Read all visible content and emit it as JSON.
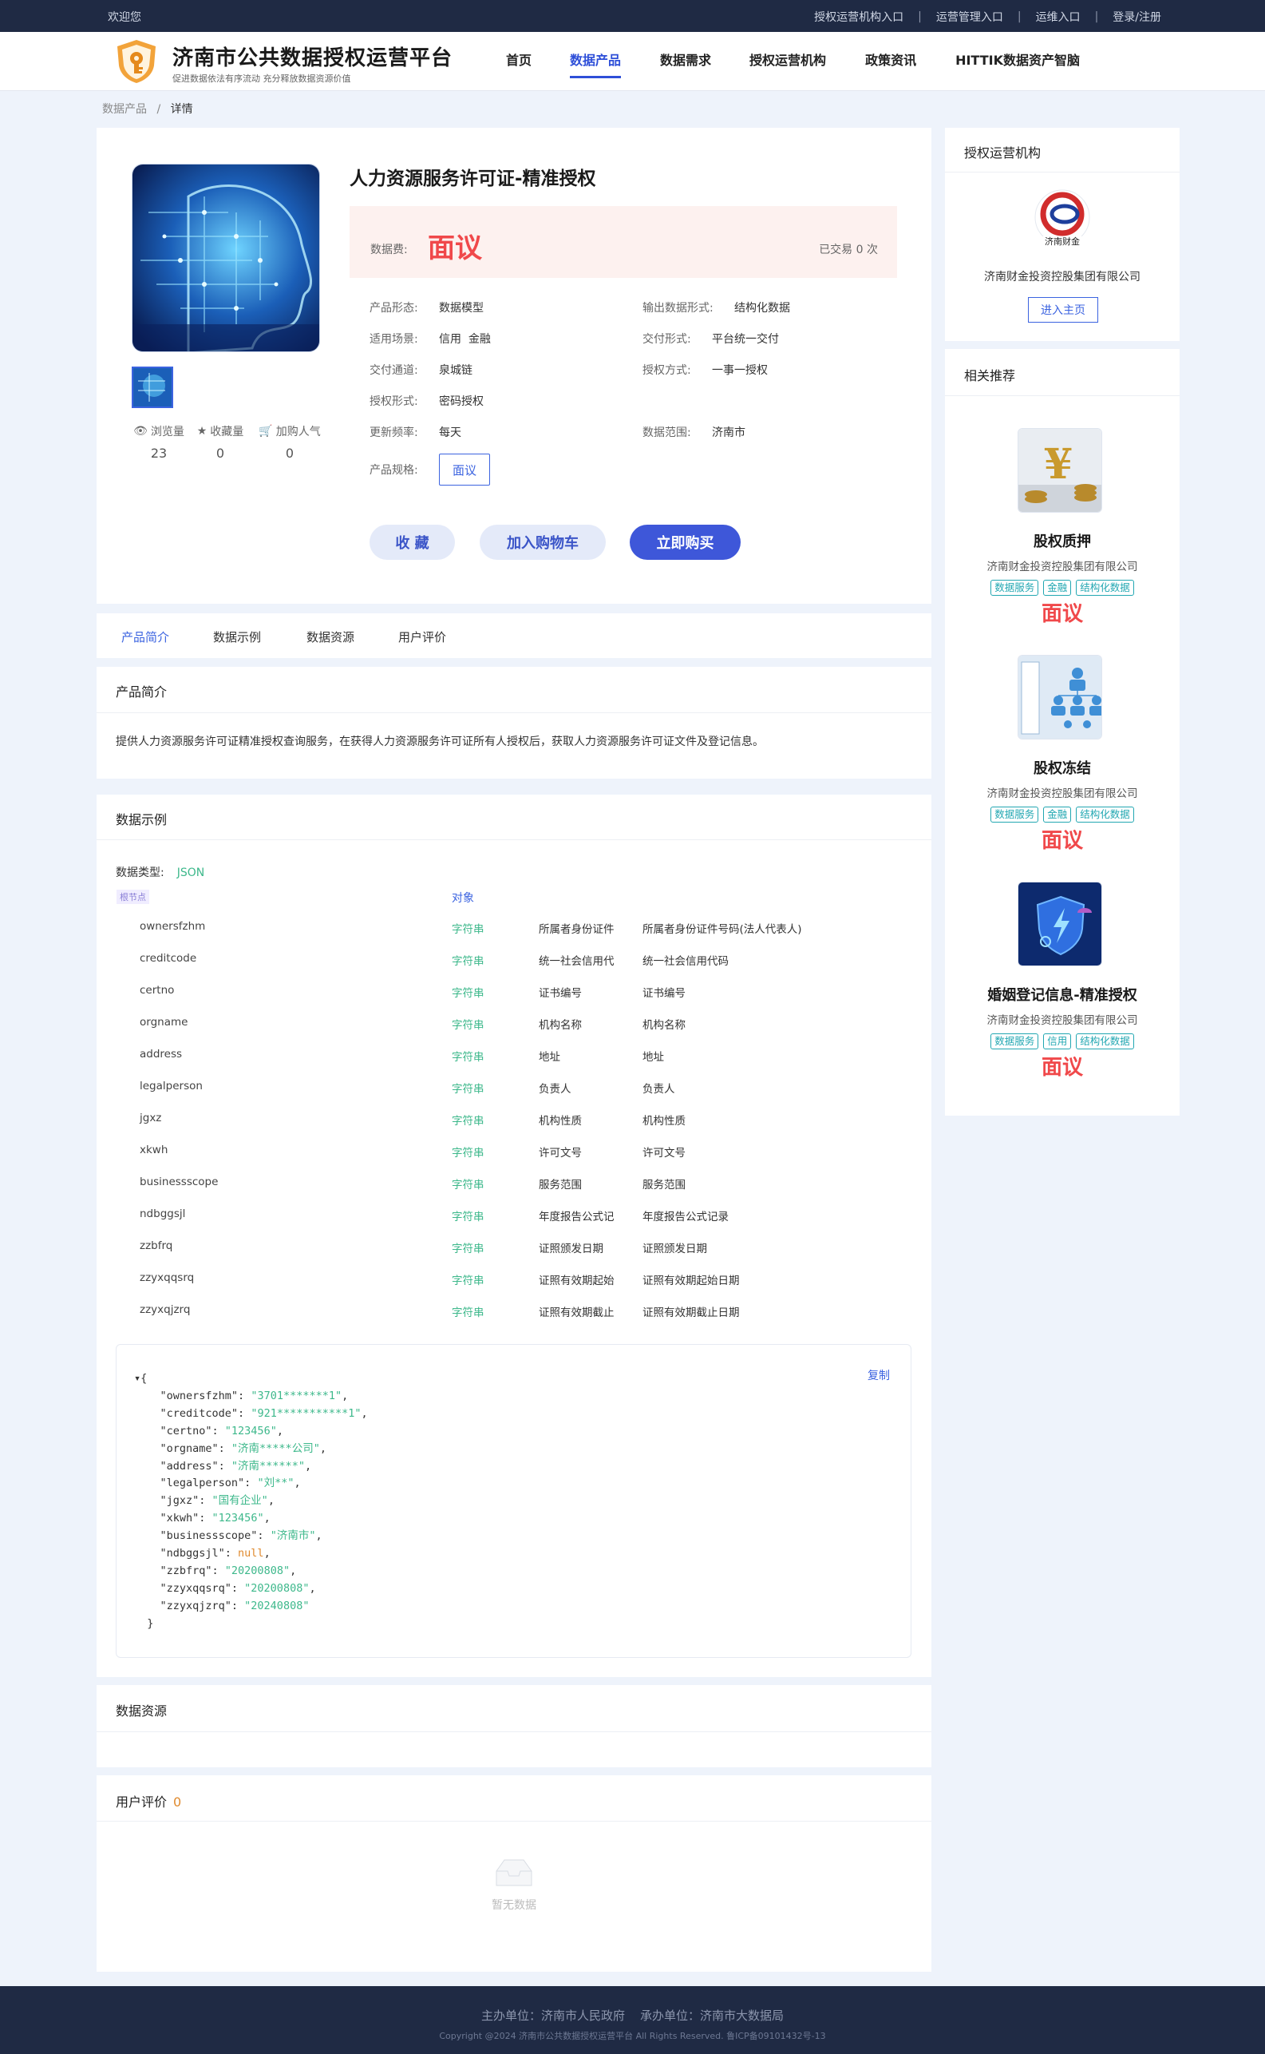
{
  "topbar": {
    "welcome": "欢迎您",
    "links": [
      "授权运营机构入口",
      "运营管理入口",
      "运维入口",
      "登录/注册"
    ]
  },
  "header": {
    "title": "济南市公共数据授权运营平台",
    "slogan": "促进数据依法有序流动 充分释放数据资源价值",
    "nav": [
      "首页",
      "数据产品",
      "数据需求",
      "授权运营机构",
      "政策资讯",
      "HITTIK数据资产智脑"
    ],
    "active_nav": "数据产品"
  },
  "breadcrumb": {
    "parent": "数据产品",
    "sep": "/",
    "current": "详情"
  },
  "product": {
    "title": "人力资源服务许可证-精准授权",
    "price_label": "数据费:",
    "price": "面议",
    "sold": "已交易 0 次",
    "attrs": {
      "form_k": "产品形态:",
      "form_v": "数据模型",
      "output_k": "输出数据形式:",
      "output_v": "结构化数据",
      "scene_k": "适用场景:",
      "scene_v": "信用  金融",
      "delivery_k": "交付形式:",
      "delivery_v": "平台统一交付",
      "channel_k": "交付通道:",
      "channel_v": "泉城链",
      "authmode_k": "授权方式:",
      "authmode_v": "一事一授权",
      "authform_k": "授权形式:",
      "authform_v": "密码授权",
      "freq_k": "更新频率:",
      "freq_v": "每天",
      "range_k": "数据范围:",
      "range_v": "济南市",
      "spec_k": "产品规格:",
      "spec_v": "面议"
    },
    "stats": {
      "views_label": "浏览量",
      "views": "23",
      "favs_label": "收藏量",
      "favs": "0",
      "cart_label": "加购人气",
      "cart": "0"
    },
    "buttons": {
      "favorite": "收 藏",
      "cart": "加入购物车",
      "buy": "立即购买"
    }
  },
  "tabs": [
    "产品简介",
    "数据示例",
    "数据资源",
    "用户评价"
  ],
  "intro": {
    "title": "产品简介",
    "text": "提供人力资源服务许可证精准授权查询服务，在获得人力资源服务许可证所有人授权后，获取人力资源服务许可证文件及登记信息。"
  },
  "sample": {
    "title": "数据示例",
    "type_label": "数据类型:",
    "type_value": "JSON",
    "root_tag": "根节点",
    "object_label": "对象",
    "fields": [
      {
        "name": "ownersfzhm",
        "type": "字符串",
        "zh": "所属者身份证件",
        "desc": "所属者身份证件号码(法人代表人)"
      },
      {
        "name": "creditcode",
        "type": "字符串",
        "zh": "统一社会信用代",
        "desc": "统一社会信用代码"
      },
      {
        "name": "certno",
        "type": "字符串",
        "zh": "证书编号",
        "desc": "证书编号"
      },
      {
        "name": "orgname",
        "type": "字符串",
        "zh": "机构名称",
        "desc": "机构名称"
      },
      {
        "name": "address",
        "type": "字符串",
        "zh": "地址",
        "desc": "地址"
      },
      {
        "name": "legalperson",
        "type": "字符串",
        "zh": "负责人",
        "desc": "负责人"
      },
      {
        "name": "jgxz",
        "type": "字符串",
        "zh": "机构性质",
        "desc": "机构性质"
      },
      {
        "name": "xkwh",
        "type": "字符串",
        "zh": "许可文号",
        "desc": "许可文号"
      },
      {
        "name": "businessscope",
        "type": "字符串",
        "zh": "服务范围",
        "desc": "服务范围"
      },
      {
        "name": "ndbggsjl",
        "type": "字符串",
        "zh": "年度报告公式记",
        "desc": "年度报告公式记录"
      },
      {
        "name": "zzbfrq",
        "type": "字符串",
        "zh": "证照颁发日期",
        "desc": "证照颁发日期"
      },
      {
        "name": "zzyxqqsrq",
        "type": "字符串",
        "zh": "证照有效期起始",
        "desc": "证照有效期起始日期"
      },
      {
        "name": "zzyxqjzrq",
        "type": "字符串",
        "zh": "证照有效期截止",
        "desc": "证照有效期截止日期"
      }
    ],
    "copy_label": "复制",
    "json": [
      {
        "k": "ownersfzhm",
        "v": "3701*******1",
        "t": "s"
      },
      {
        "k": "creditcode",
        "v": "921***********1",
        "t": "s"
      },
      {
        "k": "certno",
        "v": "123456",
        "t": "s"
      },
      {
        "k": "orgname",
        "v": "济南*****公司",
        "t": "s"
      },
      {
        "k": "address",
        "v": "济南******",
        "t": "s"
      },
      {
        "k": "legalperson",
        "v": "刘**",
        "t": "s"
      },
      {
        "k": "jgxz",
        "v": "国有企业",
        "t": "s"
      },
      {
        "k": "xkwh",
        "v": "123456",
        "t": "s"
      },
      {
        "k": "businessscope",
        "v": "济南市",
        "t": "s"
      },
      {
        "k": "ndbggsjl",
        "v": "null",
        "t": "n"
      },
      {
        "k": "zzbfrq",
        "v": "20200808",
        "t": "s"
      },
      {
        "k": "zzyxqqsrq",
        "v": "20200808",
        "t": "s"
      },
      {
        "k": "zzyxqjzrq",
        "v": "20240808",
        "t": "s"
      }
    ]
  },
  "resource": {
    "title": "数据资源"
  },
  "review": {
    "title": "用户评价",
    "count": "0",
    "empty": "暂无数据"
  },
  "side": {
    "org_title": "授权运营机构",
    "org_name": "济南财金投资控股集团有限公司",
    "org_btn": "进入主页",
    "rec_title": "相关推荐",
    "recs": [
      {
        "name": "股权质押",
        "org": "济南财金投资控股集团有限公司",
        "tags": [
          "数据服务",
          "金融",
          "结构化数据"
        ],
        "price": "面议"
      },
      {
        "name": "股权冻结",
        "org": "济南财金投资控股集团有限公司",
        "tags": [
          "数据服务",
          "金融",
          "结构化数据"
        ],
        "price": "面议"
      },
      {
        "name": "婚姻登记信息-精准授权",
        "org": "济南财金投资控股集团有限公司",
        "tags": [
          "数据服务",
          "信用",
          "结构化数据"
        ],
        "price": "面议"
      }
    ]
  },
  "footer": {
    "sponsor": "主办单位：济南市人民政府    承办单位：济南市大数据局",
    "copyright": "Copyright @2024 济南市公共数据授权运营平台 All Rights Reserved. 鲁ICP备09101432号-13"
  },
  "colors": {
    "primary": "#3e57d9",
    "price": "#f0484a",
    "topbar": "#1f2a44",
    "tag": "#22a7b2",
    "string_type": "#3db88b"
  }
}
